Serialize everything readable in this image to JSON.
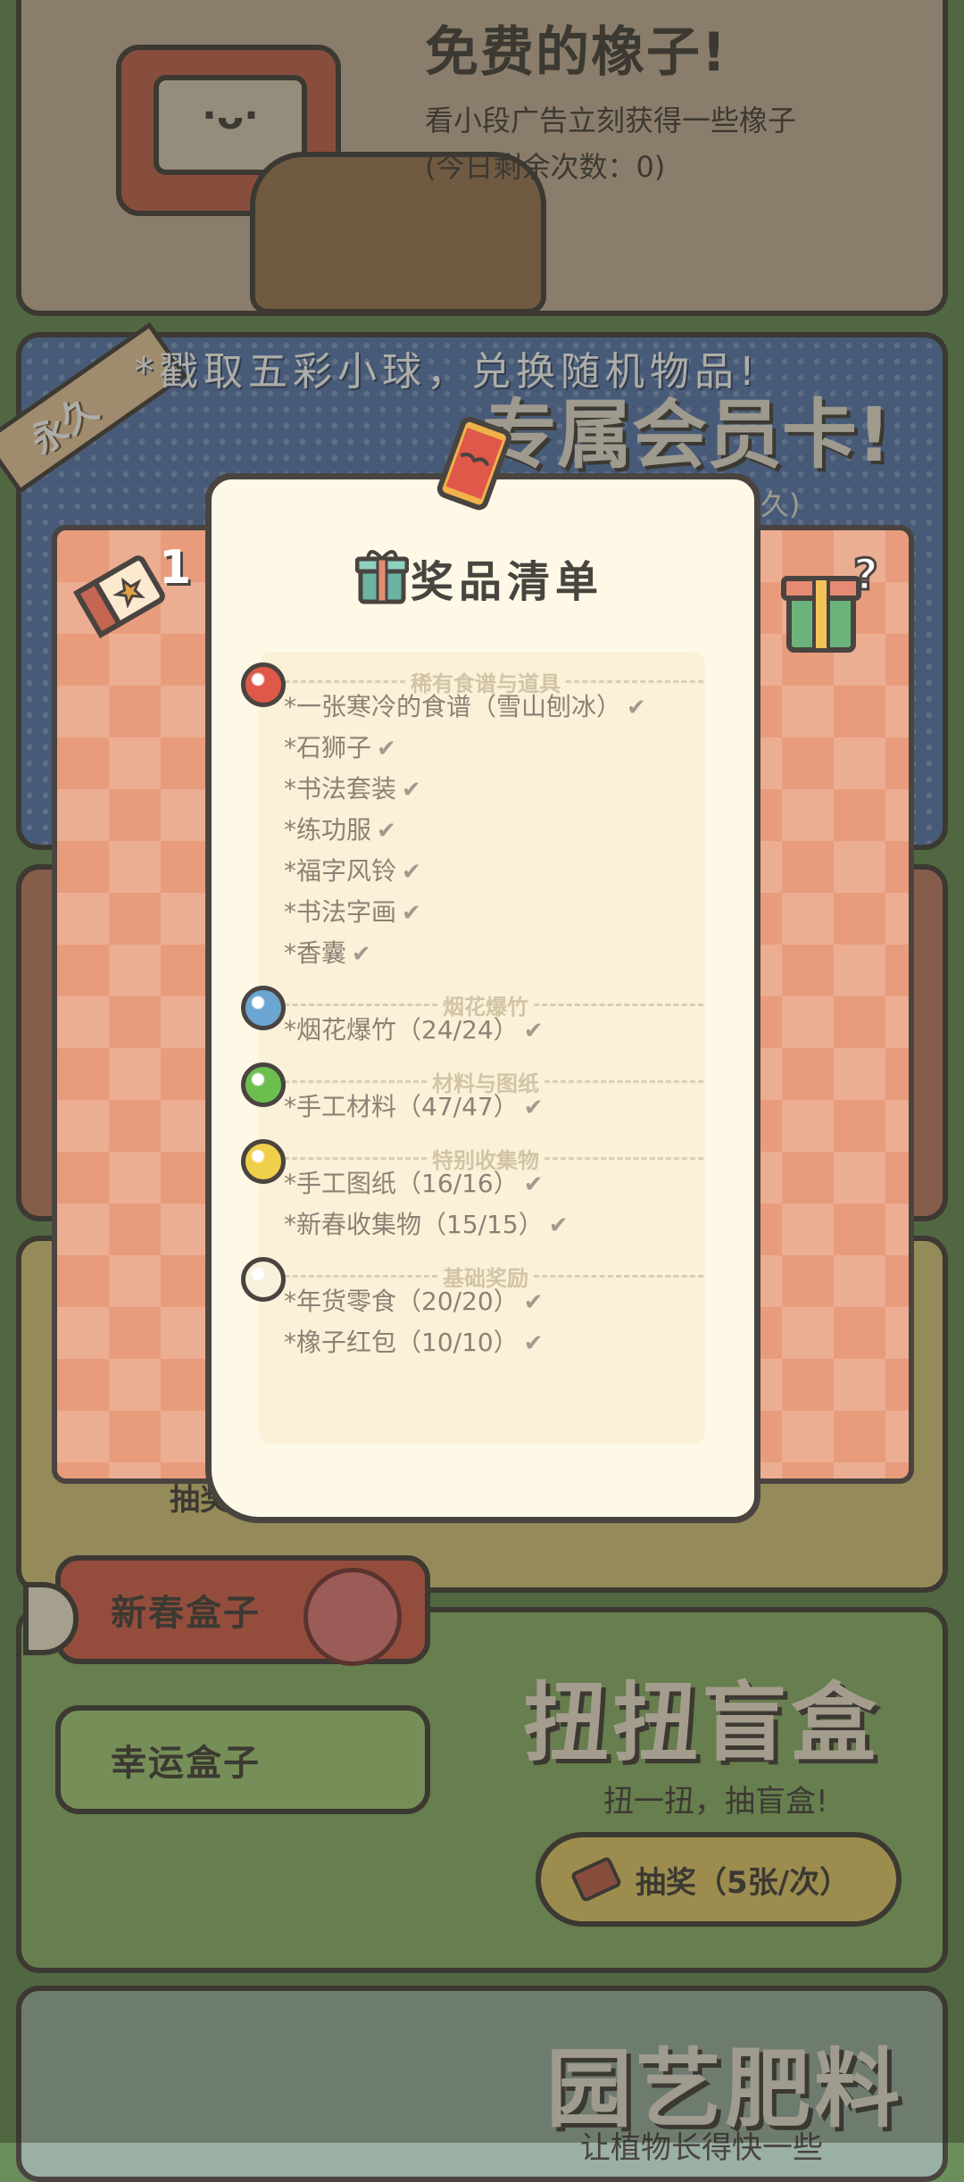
{
  "ad_card": {
    "title": "免费的橡子!",
    "subtitle": "看小段广告立刻获得一些橡子",
    "remaining": "(今日剩余次数：0)"
  },
  "member_card": {
    "permanent_ribbon": "永久",
    "banner": "*戳取五彩小球，兑换随机物品!",
    "title": "专属会员卡!",
    "subtitle": "永久)"
  },
  "prize_panel": {
    "ticket_count": "1",
    "title": "奖品清单",
    "sections": [
      {
        "heading": "稀有食谱与道具",
        "ball_color": "#e0584a",
        "items": [
          {
            "label": "*一张寒冷的食谱（雪山刨冰）"
          },
          {
            "label": "*石狮子"
          },
          {
            "label": "*书法套装"
          },
          {
            "label": "*练功服"
          },
          {
            "label": "*福字风铃"
          },
          {
            "label": "*书法字画"
          },
          {
            "label": "*香囊"
          }
        ]
      },
      {
        "heading": "烟花爆竹",
        "ball_color": "#6ba5d1",
        "items": [
          {
            "label": "*烟花爆竹（24/24）"
          }
        ]
      },
      {
        "heading": "材料与图纸",
        "ball_color": "#6cbf4f",
        "items": [
          {
            "label": "*手工材料（47/47）"
          }
        ]
      },
      {
        "heading": "特别收集物",
        "ball_color": "#f0cf4a",
        "items": [
          {
            "label": "*手工图纸（16/16）"
          },
          {
            "label": "*新春收集物（15/15）"
          }
        ]
      },
      {
        "heading": "基础奖励",
        "ball_color": "#f7f0dc",
        "items": [
          {
            "label": "*年货零食（20/20）"
          },
          {
            "label": "*橡子红包（10/10）"
          }
        ]
      }
    ],
    "check_mark": "✔"
  },
  "background_draw_button": "抽奖",
  "box_buttons": {
    "spring": "新春盒子",
    "lucky": "幸运盒子"
  },
  "gacha_card": {
    "title": "扭扭盲盒",
    "subtitle": "扭一扭，抽盲盒!",
    "draw_button": "抽奖（5张/次）"
  },
  "garden_card": {
    "title": "园艺肥料",
    "subtitle": "让植物长得快一些"
  },
  "colors": {
    "background": "#6b8f5a",
    "outline": "#4a4440",
    "sheet": "#fdf9e6",
    "accent_red": "#d7644f",
    "accent_green": "#a6cf7c",
    "accent_yellow": "#e4cc6e"
  },
  "icons": [
    "tv-mascot-icon",
    "ticket-icon",
    "gift-question-icon",
    "gift-icon",
    "charm-icon",
    "flower-icon"
  ]
}
